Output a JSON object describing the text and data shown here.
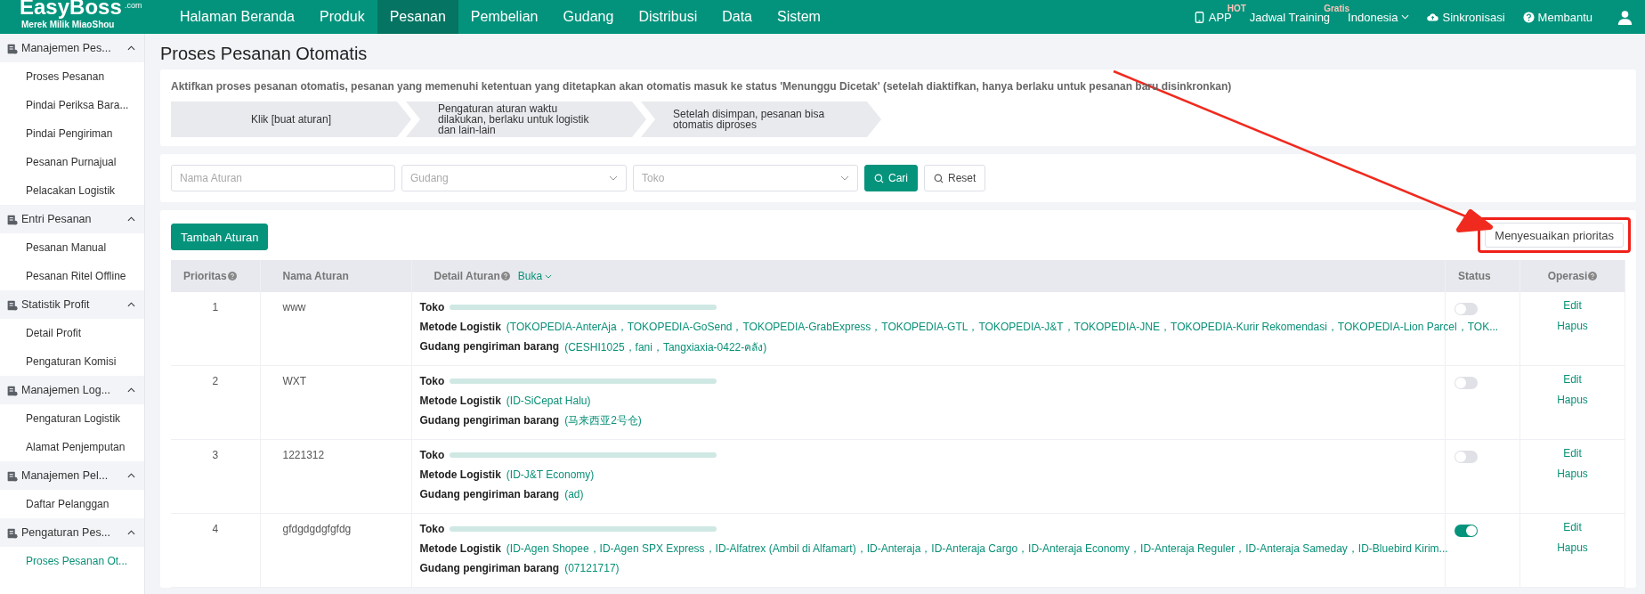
{
  "topbar": {
    "logo": {
      "name": "EasyBoss",
      "suffix": ".com",
      "tagline": "Merek Milik MiaoShou"
    },
    "nav": [
      {
        "label": "Halaman Beranda",
        "selected": false
      },
      {
        "label": "Produk",
        "selected": false
      },
      {
        "label": "Pesanan",
        "selected": true
      },
      {
        "label": "Pembelian",
        "selected": false
      },
      {
        "label": "Gudang",
        "selected": false
      },
      {
        "label": "Distribusi",
        "selected": false
      },
      {
        "label": "Data",
        "selected": false
      },
      {
        "label": "Sistem",
        "selected": false
      }
    ],
    "right": [
      {
        "kind": "app",
        "label": "APP",
        "badge": "HOT"
      },
      {
        "kind": "training",
        "label": "Jadwal Training",
        "badge": "Gratis"
      },
      {
        "kind": "language",
        "label": "Indonesia"
      },
      {
        "kind": "sync",
        "label": "Sinkronisasi"
      },
      {
        "kind": "help",
        "label": "Membantu"
      },
      {
        "kind": "user"
      }
    ]
  },
  "sidebar": {
    "groups": [
      {
        "label": "Manajemen Pes...",
        "expanded": true,
        "items": [
          {
            "label": "Proses Pesanan",
            "selected": false
          },
          {
            "label": "Pindai Periksa Bara...",
            "selected": false
          },
          {
            "label": "Pindai Pengiriman",
            "selected": false
          },
          {
            "label": "Pesanan Purnajual",
            "selected": false
          },
          {
            "label": "Pelacakan Logistik",
            "selected": false
          }
        ]
      },
      {
        "label": "Entri Pesanan",
        "expanded": true,
        "items": [
          {
            "label": "Pesanan Manual",
            "selected": false
          },
          {
            "label": "Pesanan Ritel Offline",
            "selected": false
          }
        ]
      },
      {
        "label": "Statistik Profit",
        "expanded": true,
        "items": [
          {
            "label": "Detail Profit",
            "selected": false
          },
          {
            "label": "Pengaturan Komisi",
            "selected": false
          }
        ]
      },
      {
        "label": "Manajemen Log...",
        "expanded": true,
        "items": [
          {
            "label": "Pengaturan Logistik",
            "selected": false
          },
          {
            "label": "Alamat Penjemputan",
            "selected": false
          }
        ]
      },
      {
        "label": "Manajemen Pel...",
        "expanded": true,
        "items": [
          {
            "label": "Daftar Pelanggan",
            "selected": false
          }
        ]
      },
      {
        "label": "Pengaturan Pes...",
        "expanded": true,
        "items": [
          {
            "label": "Proses Pesanan Ot...",
            "selected": true
          }
        ]
      }
    ]
  },
  "page": {
    "title": "Proses Pesanan Otomatis",
    "info": "Aktifkan proses pesanan otomatis, pesanan yang memenuhi ketentuan yang ditetapkan akan otomatis masuk ke status 'Menunggu Dicetak' (setelah diaktifkan, hanya berlaku untuk pesanan baru disinkronkan)",
    "steps": [
      "Klik [buat aturan]",
      "Pengaturan aturan waktu dilakukan, berlaku untuk logistik dan lain-lain",
      "Setelah disimpan, pesanan bisa otomatis diproses"
    ],
    "filters": [
      {
        "kind": "input",
        "placeholder": "Nama Aturan"
      },
      {
        "kind": "select",
        "placeholder": "Gudang"
      },
      {
        "kind": "select",
        "placeholder": "Toko"
      }
    ],
    "search_button": "Cari",
    "reset_button": "Reset",
    "add_button": "Tambah Aturan",
    "priority_button": "Menyesuaikan prioritas"
  },
  "table": {
    "columns": [
      {
        "label": "Prioritas",
        "help": true
      },
      {
        "label": "Nama Aturan",
        "help": false
      },
      {
        "label": "Detail Aturan",
        "help": true,
        "link": "Buka"
      },
      {
        "label": "Status",
        "help": false
      },
      {
        "label": "Operasi",
        "help": true
      }
    ],
    "rows": [
      {
        "priority": "1",
        "name": "www",
        "details": [
          {
            "label": "Toko",
            "kind": "redacted"
          },
          {
            "label": "Metode Logistik",
            "kind": "text",
            "value": "(TOKOPEDIA-AnterAja，TOKOPEDIA-GoSend，TOKOPEDIA-GrabExpress，TOKOPEDIA-GTL，TOKOPEDIA-J&T，TOKOPEDIA-JNE，TOKOPEDIA-Kurir Rekomendasi，TOKOPEDIA-Lion Parcel，TOK..."
          },
          {
            "label": "Gudang pengiriman barang",
            "kind": "text",
            "value": "(CESHI1025，fani，Tangxiaxia-0422-คลัง)"
          }
        ],
        "on": false,
        "actions": [
          "Edit",
          "Hapus"
        ]
      },
      {
        "priority": "2",
        "name": "WXT",
        "details": [
          {
            "label": "Toko",
            "kind": "redacted"
          },
          {
            "label": "Metode Logistik",
            "kind": "text",
            "value": "(ID-SiCepat Halu)"
          },
          {
            "label": "Gudang pengiriman barang",
            "kind": "text",
            "value": "(马来西亚2号仓)"
          }
        ],
        "on": false,
        "actions": [
          "Edit",
          "Hapus"
        ]
      },
      {
        "priority": "3",
        "name": "1221312",
        "details": [
          {
            "label": "Toko",
            "kind": "redacted"
          },
          {
            "label": "Metode Logistik",
            "kind": "text",
            "value": "(ID-J&T Economy)"
          },
          {
            "label": "Gudang pengiriman barang",
            "kind": "text",
            "value": "(ad)"
          }
        ],
        "on": false,
        "actions": [
          "Edit",
          "Hapus"
        ]
      },
      {
        "priority": "4",
        "name": "gfdgdgdgfgfdg",
        "details": [
          {
            "label": "Toko",
            "kind": "redacted"
          },
          {
            "label": "Metode Logistik",
            "kind": "text",
            "value": "(ID-Agen Shopee，ID-Agen SPX Express，ID-Alfatrex (Ambil di Alfamart)，ID-Anteraja，ID-Anteraja Cargo，ID-Anteraja Economy，ID-Anteraja Reguler，ID-Anteraja Sameday，ID-Bluebird Kirim..."
          },
          {
            "label": "Gudang pengiriman barang",
            "kind": "text",
            "value": "(07121717)"
          }
        ],
        "on": true,
        "actions": [
          "Edit",
          "Hapus"
        ]
      }
    ]
  }
}
